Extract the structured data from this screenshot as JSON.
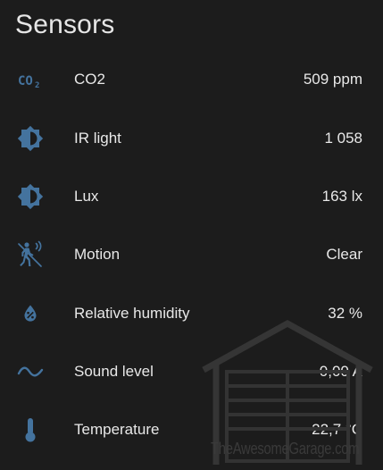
{
  "card": {
    "title": "Sensors"
  },
  "colors": {
    "background": "#1c1c1c",
    "icon": "#44739e",
    "text": "#e8e8e8",
    "watermark": "#3a3a3a"
  },
  "sensors": [
    {
      "icon": "co2-icon",
      "name": "CO2",
      "value": "509 ppm"
    },
    {
      "icon": "brightness-icon",
      "name": "IR light",
      "value": "1 058"
    },
    {
      "icon": "brightness-icon",
      "name": "Lux",
      "value": "163 lx"
    },
    {
      "icon": "motion-sensor-off-icon",
      "name": "Motion",
      "value": "Clear"
    },
    {
      "icon": "water-percent-icon",
      "name": "Relative humidity",
      "value": "32 %"
    },
    {
      "icon": "sine-wave-icon",
      "name": "Sound level",
      "value": "0,00 A"
    },
    {
      "icon": "thermometer-icon",
      "name": "Temperature",
      "value": "22,7 °C"
    }
  ],
  "watermark": {
    "text": "TheAwesomeGarage.com"
  }
}
